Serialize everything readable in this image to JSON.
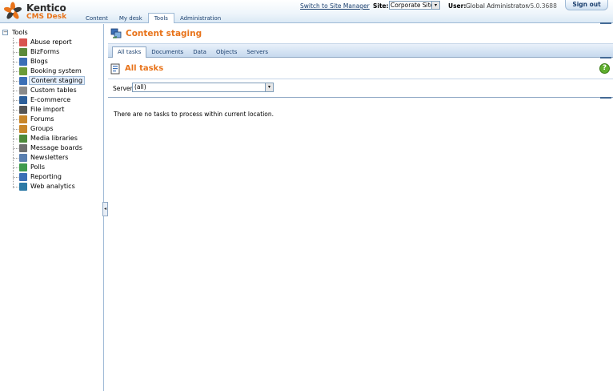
{
  "header": {
    "logo_name": "Kentico",
    "logo_sub": "CMS Desk",
    "tabs": [
      {
        "label": "Content"
      },
      {
        "label": "My desk"
      },
      {
        "label": "Tools"
      },
      {
        "label": "Administration"
      }
    ],
    "active_tab": "Tools",
    "switch_link": "Switch to Site Manager",
    "site_label": "Site:",
    "site_value": "Corporate Site",
    "user_label": "User:",
    "user_value": "Global Administrator",
    "version": "v5.0.3688",
    "signout_label": "Sign out"
  },
  "tree": {
    "root_toggle": "−",
    "root_label": "Tools",
    "items": [
      {
        "label": "Abuse report",
        "icon": "abuse-report-icon",
        "color": "#d9534f"
      },
      {
        "label": "BizForms",
        "icon": "bizforms-icon",
        "color": "#5b8a3a"
      },
      {
        "label": "Blogs",
        "icon": "blogs-icon",
        "color": "#3b6fb6"
      },
      {
        "label": "Booking system",
        "icon": "booking-system-icon",
        "color": "#6b9b37"
      },
      {
        "label": "Content staging",
        "icon": "content-staging-icon",
        "color": "#3b6fb6"
      },
      {
        "label": "Custom tables",
        "icon": "custom-tables-icon",
        "color": "#8a8a8a"
      },
      {
        "label": "E-commerce",
        "icon": "ecommerce-icon",
        "color": "#2d5f9a"
      },
      {
        "label": "File import",
        "icon": "file-import-icon",
        "color": "#555555"
      },
      {
        "label": "Forums",
        "icon": "forums-icon",
        "color": "#c8862a"
      },
      {
        "label": "Groups",
        "icon": "groups-icon",
        "color": "#c8862a"
      },
      {
        "label": "Media libraries",
        "icon": "media-libraries-icon",
        "color": "#4d8a3a"
      },
      {
        "label": "Message boards",
        "icon": "message-boards-icon",
        "color": "#6f6f6f"
      },
      {
        "label": "Newsletters",
        "icon": "newsletters-icon",
        "color": "#5a7fb0"
      },
      {
        "label": "Polls",
        "icon": "polls-icon",
        "color": "#3f9a4d"
      },
      {
        "label": "Reporting",
        "icon": "reporting-icon",
        "color": "#3b6fb6"
      },
      {
        "label": "Web analytics",
        "icon": "web-analytics-icon",
        "color": "#2d7aa6"
      }
    ],
    "selected_item": "Content staging"
  },
  "collapse_handle": "◂",
  "main": {
    "title": "Content staging",
    "sub_tabs": [
      {
        "label": "All tasks"
      },
      {
        "label": "Documents"
      },
      {
        "label": "Data"
      },
      {
        "label": "Objects"
      },
      {
        "label": "Servers"
      }
    ],
    "active_sub_tab": "All tasks",
    "section_title": "All tasks",
    "help_glyph": "?",
    "server_label": "Server:",
    "server_value": "(all)",
    "dropdown_glyph": "▾",
    "empty_message": "There are no tasks to process within current location."
  },
  "colors": {
    "accent_orange": "#e8731a",
    "link_blue": "#1a3f6e",
    "border_blue": "#9fbad6",
    "help_green": "#5fae2e"
  }
}
